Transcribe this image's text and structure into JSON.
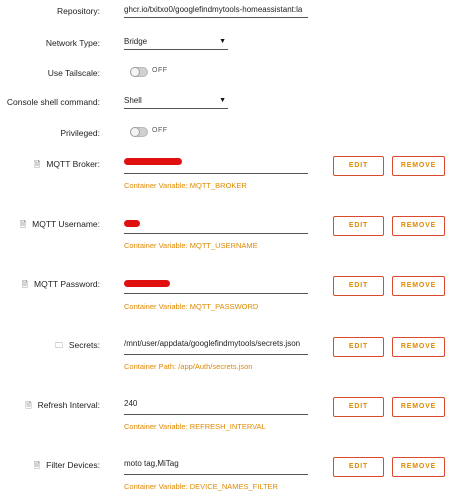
{
  "fields": {
    "repository": {
      "label": "Repository:",
      "value": "ghcr.io/txitxo0/googlefindmytools-homeassistant:la"
    },
    "network_type": {
      "label": "Network Type:",
      "value": "Bridge"
    },
    "use_tailscale": {
      "label": "Use Tailscale:",
      "state": "OFF"
    },
    "console_shell": {
      "label": "Console shell command:",
      "value": "Shell"
    },
    "privileged": {
      "label": "Privileged:",
      "state": "OFF"
    }
  },
  "buttons": {
    "edit": "EDIT",
    "remove": "REMOVE"
  },
  "config_items": [
    {
      "label": "MQTT Broker:",
      "icon": "file-icon",
      "value": "",
      "redacted": true,
      "sub": "Container Variable: MQTT_BROKER"
    },
    {
      "label": "MQTT Username:",
      "icon": "file-icon",
      "value": "",
      "redacted": true,
      "sub": "Container Variable: MQTT_USERNAME"
    },
    {
      "label": "MQTT Password:",
      "icon": "file-icon",
      "value": "",
      "redacted": true,
      "sub": "Container Variable: MQTT_PASSWORD"
    },
    {
      "label": "Secrets:",
      "icon": "folder-icon",
      "value": "/mnt/user/appdata/googlefindmytools/secrets.json",
      "redacted": false,
      "sub": "Container Path: /app/Auth/secrets.json"
    },
    {
      "label": "Refresh Interval:",
      "icon": "file-icon",
      "value": "240",
      "redacted": false,
      "sub": "Container Variable: REFRESH_INTERVAL"
    },
    {
      "label": "Filter Devices:",
      "icon": "file-icon",
      "value": "moto tag,MiTag",
      "redacted": false,
      "sub": "Container Variable: DEVICE_NAMES_FILTER"
    }
  ]
}
